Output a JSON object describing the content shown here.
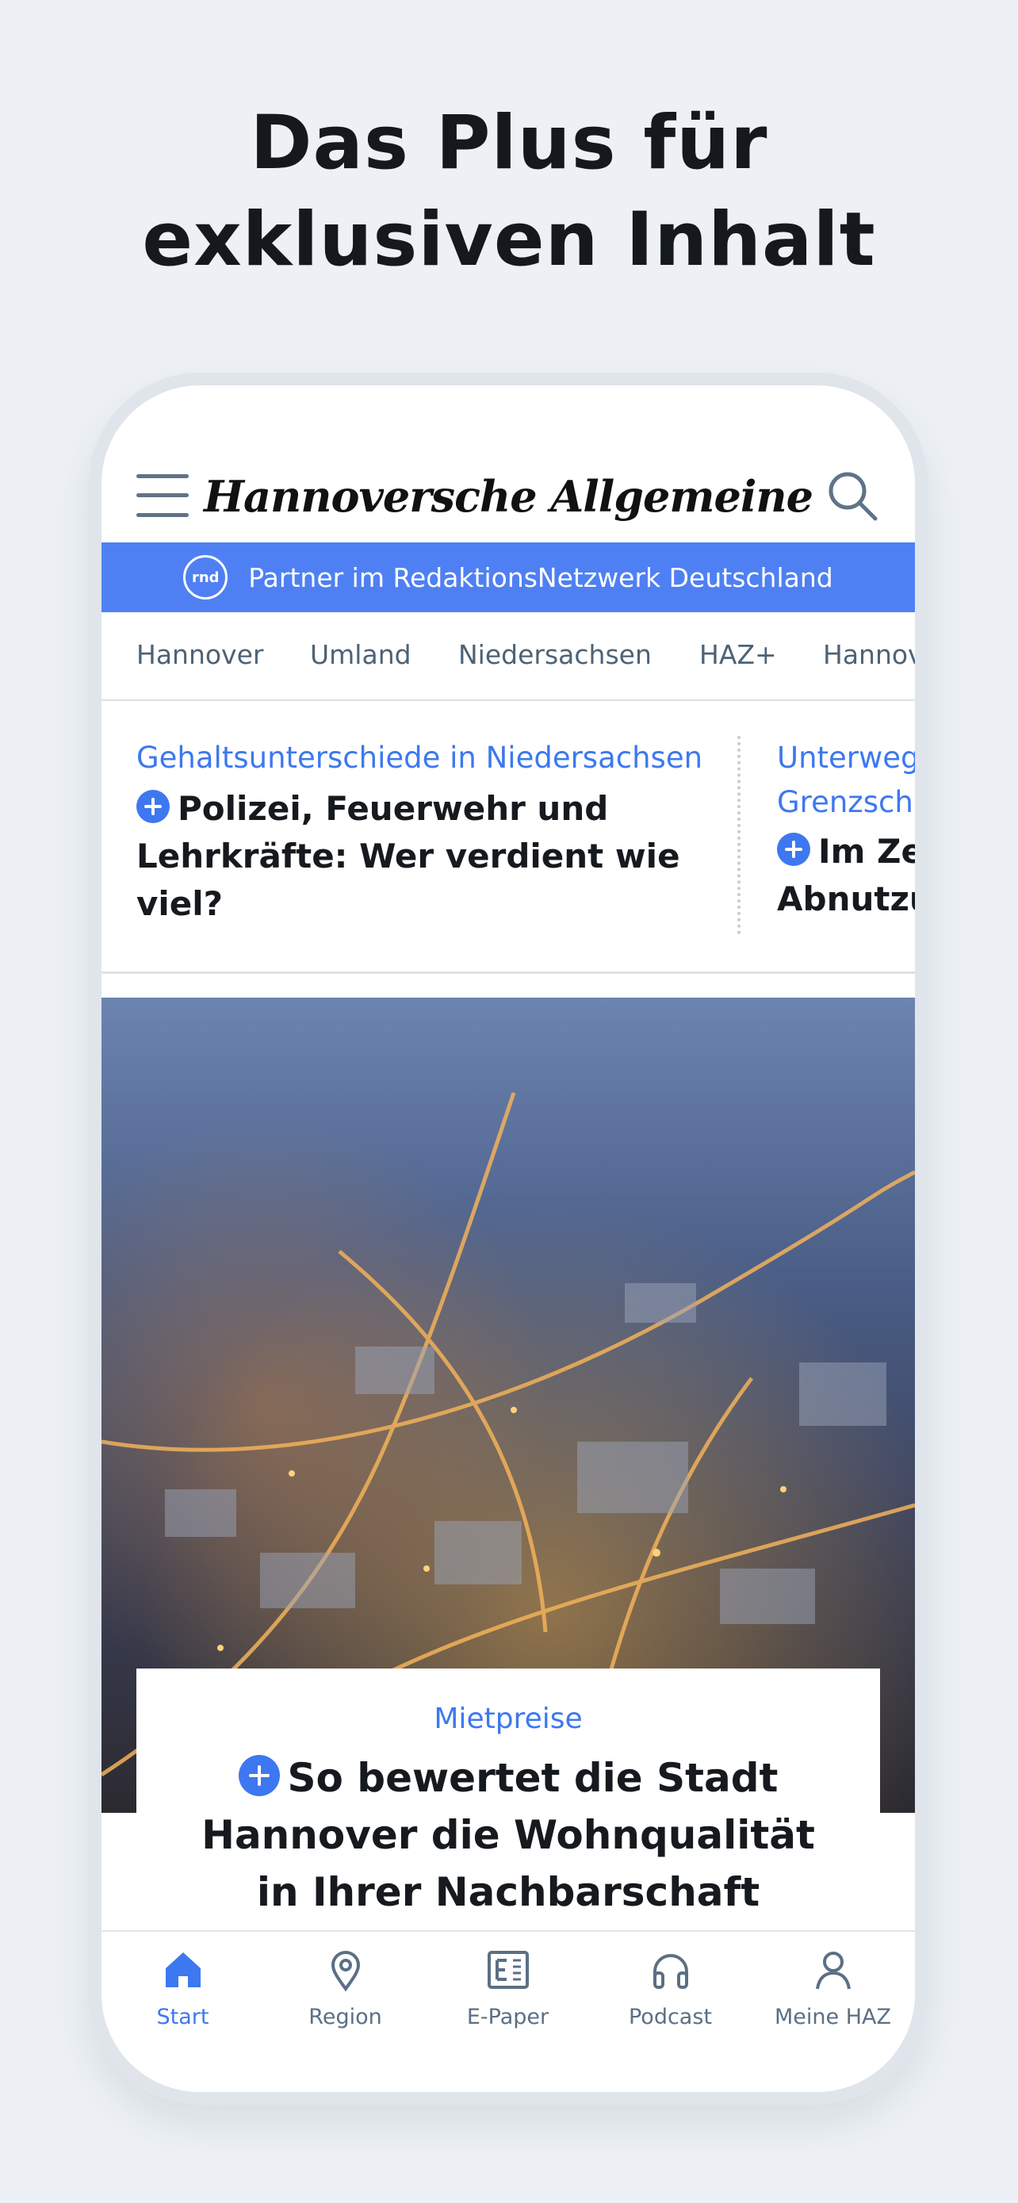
{
  "promo": {
    "line1": "Das Plus für",
    "line2": "exklusiven Inhalt"
  },
  "header": {
    "logo": "Hannoversche Allgemeine",
    "menu_icon": "menu-icon",
    "search_icon": "search-icon"
  },
  "partner_bar": {
    "badge": "rnd",
    "text": "Partner im RedaktionsNetzwerk Deutschland",
    "color": "#4f80f3"
  },
  "nav": {
    "items": [
      "Hannover",
      "Umland",
      "Niedersachsen",
      "HAZ+",
      "Hannov"
    ]
  },
  "teasers": [
    {
      "kicker": "Gehaltsunterschiede in Niedersachsen",
      "title": "Polizei, Feuerwehr und Lehrkräfte: Wer verdient wie viel?",
      "plus": true
    },
    {
      "kicker": "Unterweg Grenzsch",
      "title": "Im Ze Abnutzu",
      "plus": true
    }
  ],
  "hero": {
    "image": "aerial night view of Hannover city",
    "kicker": "Mietpreise",
    "title": "So bewertet die Stadt Hannover die Wohnqualität in Ihrer Nachbarschaft",
    "plus": true
  },
  "tabbar": {
    "active": "Start",
    "items": [
      {
        "label": "Start",
        "icon": "home-icon"
      },
      {
        "label": "Region",
        "icon": "location-pin-icon"
      },
      {
        "label": "E-Paper",
        "icon": "epaper-icon"
      },
      {
        "label": "Podcast",
        "icon": "headphones-icon"
      },
      {
        "label": "Meine HAZ",
        "icon": "user-icon"
      }
    ]
  },
  "colors": {
    "accent": "#3d78f0",
    "background": "#edf1f5",
    "tab_inactive": "#5b6f84"
  }
}
